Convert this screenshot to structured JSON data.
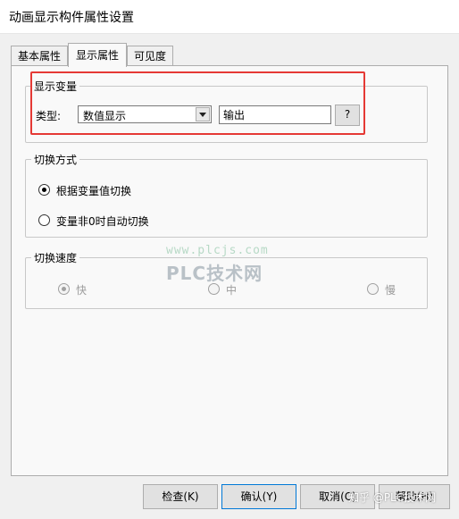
{
  "window": {
    "title": "动画显示构件属性设置"
  },
  "tabs": [
    {
      "label": "基本属性"
    },
    {
      "label": "显示属性"
    },
    {
      "label": "可见度"
    }
  ],
  "display_variable": {
    "group_label": "显示变量",
    "type_label": "类型:",
    "type_value": "数值显示",
    "expression_value": "输出",
    "help_button": "?"
  },
  "switch_mode": {
    "group_label": "切换方式",
    "options": [
      {
        "label": "根据变量值切换",
        "checked": true
      },
      {
        "label": "变量非0时自动切换",
        "checked": false
      }
    ]
  },
  "switch_speed": {
    "group_label": "切换速度",
    "options": [
      {
        "label": "快",
        "checked": true
      },
      {
        "label": "中",
        "checked": false
      },
      {
        "label": "慢",
        "checked": false
      }
    ]
  },
  "watermark": {
    "url": "www.plcjs.com",
    "brand": "PLC技术网",
    "bottom": "知乎 @PLC技术网"
  },
  "buttons": {
    "check": "检查(K)",
    "confirm": "确认(Y)",
    "cancel": "取消(C)",
    "help": "帮助(H)"
  },
  "colors": {
    "highlight": "#e53935",
    "window_bg": "#f0f0f0",
    "panel_bg": "#f9f9f9"
  }
}
